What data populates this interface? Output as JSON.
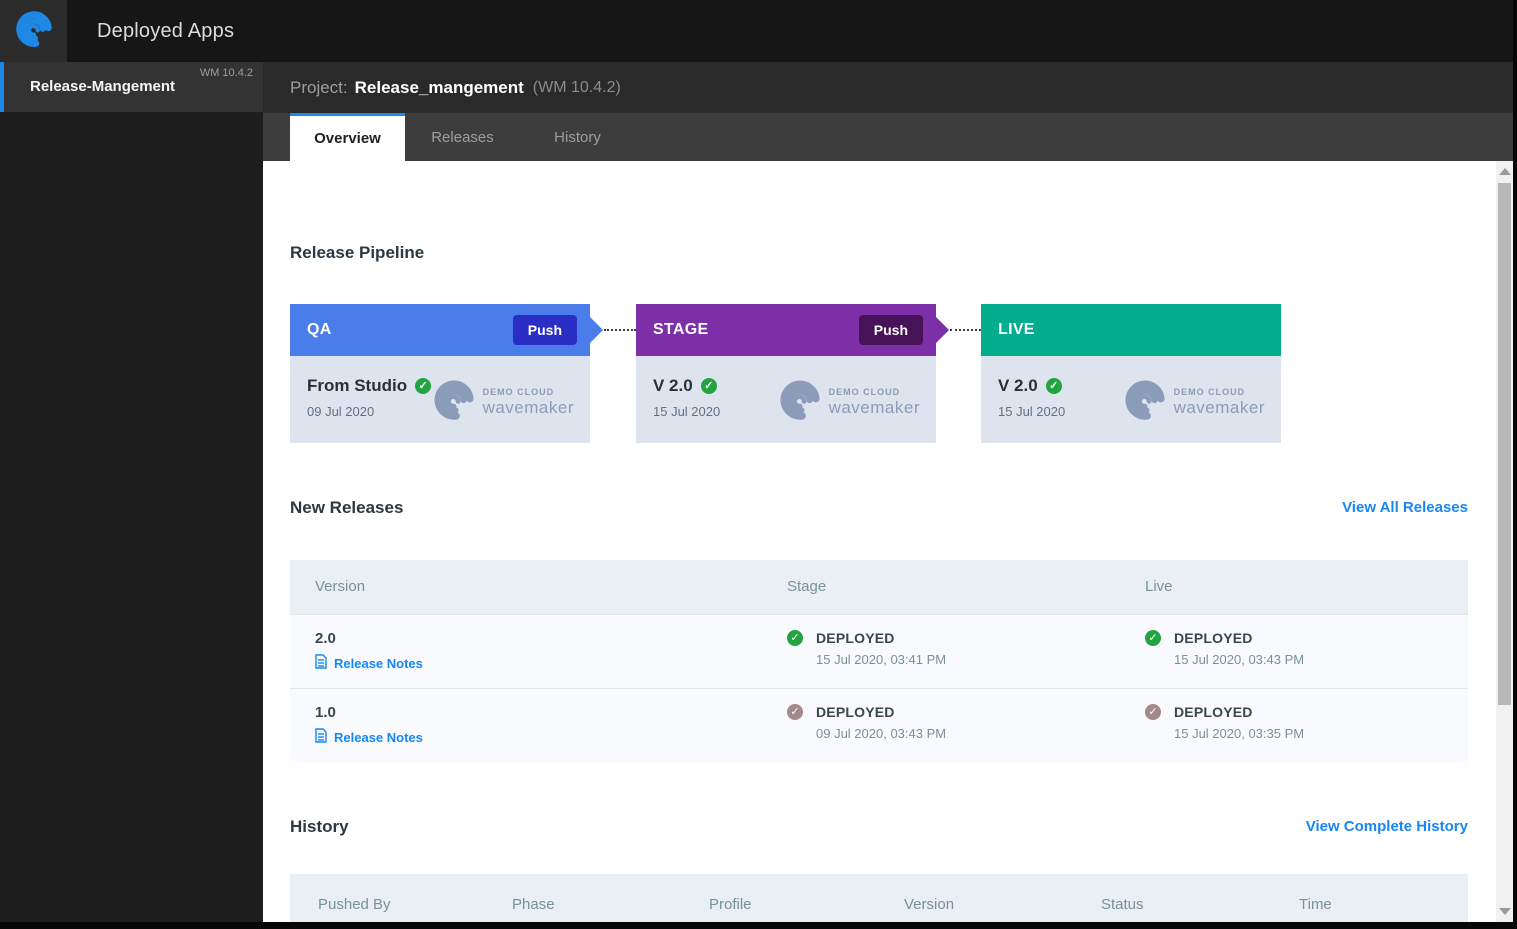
{
  "topbar": {
    "title": "Deployed Apps"
  },
  "sidebar": {
    "item": {
      "name": "Release-Mangement",
      "version": "WM 10.4.2"
    }
  },
  "header": {
    "label": "Project:",
    "project_name": "Release_mangement",
    "version": "(WM 10.4.2)"
  },
  "tabs": [
    {
      "label": "Overview",
      "active": true
    },
    {
      "label": "Releases",
      "active": false
    },
    {
      "label": "History",
      "active": false
    }
  ],
  "pipeline": {
    "title": "Release Pipeline",
    "stages": [
      {
        "name": "QA",
        "push_label": "Push",
        "version": "From Studio",
        "date": "09 Jul 2020",
        "logo_top": "DEMO CLOUD",
        "logo_bottom": "wavemaker"
      },
      {
        "name": "STAGE",
        "push_label": "Push",
        "version": "V 2.0",
        "date": "15 Jul 2020",
        "logo_top": "DEMO CLOUD",
        "logo_bottom": "wavemaker"
      },
      {
        "name": "LIVE",
        "version": "V 2.0",
        "date": "15 Jul 2020",
        "logo_top": "DEMO CLOUD",
        "logo_bottom": "wavemaker"
      }
    ]
  },
  "new_releases": {
    "title": "New Releases",
    "view_all_label": "View All Releases",
    "columns": [
      "Version",
      "Stage",
      "Live"
    ],
    "rows": [
      {
        "version": "2.0",
        "release_notes_label": "Release Notes",
        "stage": {
          "status": "DEPLOYED",
          "time": "15 Jul 2020, 03:41 PM"
        },
        "live": {
          "status": "DEPLOYED",
          "time": "15 Jul 2020, 03:43 PM"
        }
      },
      {
        "version": "1.0",
        "release_notes_label": "Release Notes",
        "stage": {
          "status": "DEPLOYED",
          "time": "09 Jul 2020, 03:43 PM"
        },
        "live": {
          "status": "DEPLOYED",
          "time": "15 Jul 2020, 03:35 PM"
        }
      }
    ]
  },
  "history": {
    "title": "History",
    "view_all_label": "View Complete History",
    "columns": [
      "Pushed By",
      "Phase",
      "Profile",
      "Version",
      "Status",
      "Time"
    ]
  },
  "colors": {
    "accent_blue": "#1e88e5",
    "link_blue": "#1787f5",
    "qa_header": "#4a7de9",
    "qa_push": "#2b2ec4",
    "stage_header": "#7d2fa8",
    "stage_push": "#471356",
    "live_header": "#01ad8d",
    "status_fresh_green": "#23a440",
    "status_stale_mauve": "#a38989",
    "card_body": "#dde4ee",
    "table_header_bg": "#e9eff2"
  }
}
